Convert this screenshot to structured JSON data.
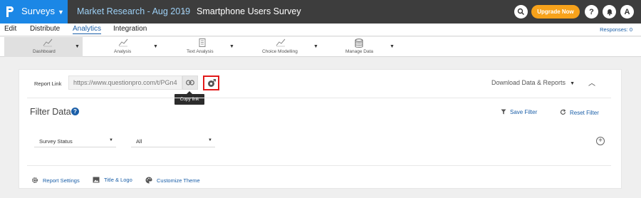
{
  "topbar": {
    "app_name": "Surveys",
    "breadcrumb_folder": "Market Research - Aug 2019",
    "breadcrumb_survey": "Smartphone Users Survey",
    "upgrade_label": "Upgrade Now",
    "help_label": "?",
    "avatar_label": "A",
    "colors": {
      "bar": "#3d3d3d",
      "logo": "#1b87e6",
      "upgrade": "#f7a21b"
    }
  },
  "subnav": {
    "items": [
      {
        "label": "Edit"
      },
      {
        "label": "Distribute"
      },
      {
        "label": "Analytics",
        "active": true
      },
      {
        "label": "Integration"
      }
    ],
    "responses": "Responses: 0"
  },
  "toolbar": {
    "tabs": [
      {
        "label": "Dashboard",
        "icon": "line-chart-icon",
        "active": true
      },
      {
        "label": "Analysis",
        "icon": "line-chart-icon"
      },
      {
        "label": "Text Analysis",
        "icon": "document-icon"
      },
      {
        "label": "Choice Modelling",
        "icon": "line-chart-icon"
      },
      {
        "label": "Manage Data",
        "icon": "database-icon"
      }
    ]
  },
  "report": {
    "link_label": "Report Link",
    "link_value": "https://www.questionpro.com/t/PGn4",
    "copy_tooltip": "Copy link",
    "download_label": "Download Data & Reports"
  },
  "filter": {
    "title": "Filter Data",
    "save_label": "Save Filter",
    "reset_label": "Reset Filter",
    "field_select": "Survey Status",
    "value_select": "All"
  },
  "footer": {
    "report_settings": "Report Settings",
    "title_logo": "Title & Logo",
    "customize_theme": "Customize Theme"
  }
}
